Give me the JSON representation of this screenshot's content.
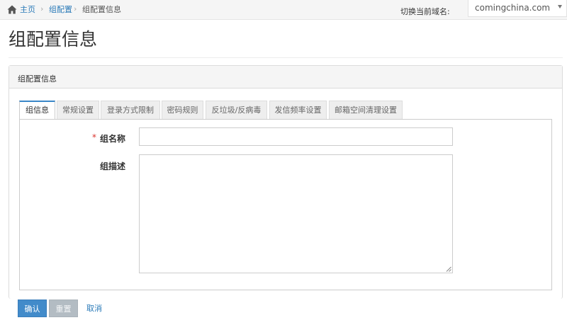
{
  "breadcrumb": {
    "home": "主页",
    "group_config": "组配置",
    "current": "组配置信息"
  },
  "domain_switch": {
    "label": "切换当前域名:",
    "selected": "comingchina.com"
  },
  "page_title": "组配置信息",
  "panel_title": "组配置信息",
  "tabs": [
    {
      "label": "组信息",
      "active": true
    },
    {
      "label": "常规设置",
      "active": false
    },
    {
      "label": "登录方式限制",
      "active": false
    },
    {
      "label": "密码规则",
      "active": false
    },
    {
      "label": "反垃圾/反病毒",
      "active": false
    },
    {
      "label": "发信频率设置",
      "active": false
    },
    {
      "label": "邮箱空间清理设置",
      "active": false
    }
  ],
  "form": {
    "required_mark": "*",
    "name_label": "组名称",
    "name_value": "",
    "desc_label": "组描述",
    "desc_value": ""
  },
  "actions": {
    "confirm": "确认",
    "reset": "重置",
    "cancel": "取消"
  },
  "colors": {
    "accent": "#428bca",
    "link": "#2a7ab8",
    "required": "#d9322d",
    "disabled_button": "#b3bcc3"
  },
  "icons": {
    "home": "home-icon",
    "domain_dropdown": "chevron-down-icon"
  }
}
